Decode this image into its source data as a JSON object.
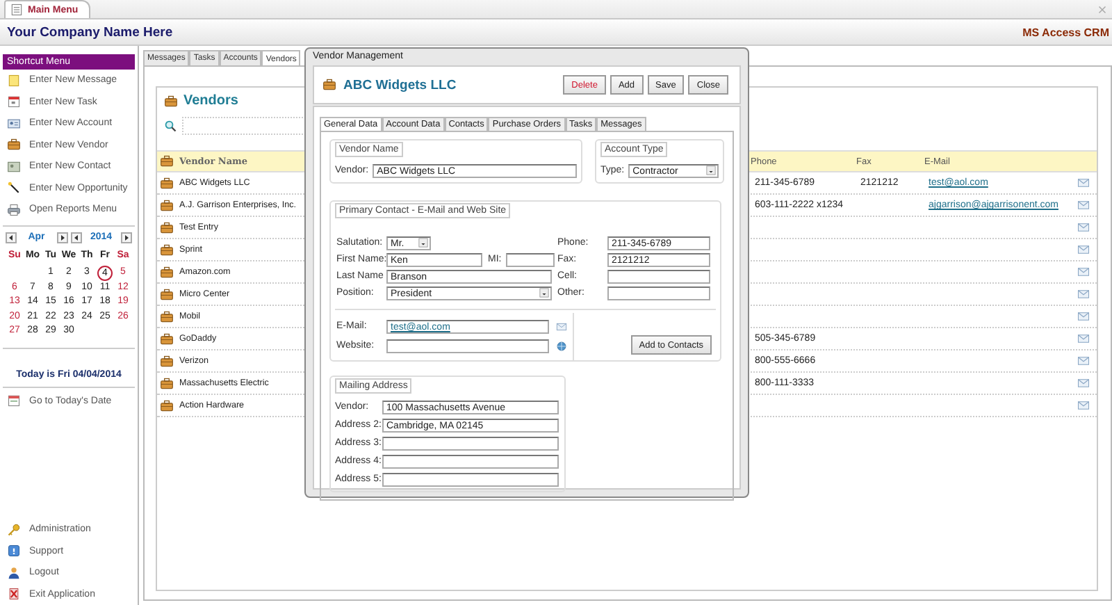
{
  "window": {
    "tab": "Main Menu"
  },
  "header": {
    "company": "Your Company Name Here",
    "app": "MS Access CRM"
  },
  "sidebar": {
    "title": "Shortcut Menu",
    "items": [
      {
        "label": "Enter New Message",
        "kind": "message"
      },
      {
        "label": "Enter New Task",
        "kind": "task"
      },
      {
        "label": "Enter New Account",
        "kind": "account"
      },
      {
        "label": "Enter New Vendor",
        "kind": "vendor"
      },
      {
        "label": "Enter New Contact",
        "kind": "contact"
      },
      {
        "label": "Enter New Opportunity",
        "kind": "opportunity"
      },
      {
        "label": "Open Reports Menu",
        "kind": "reports"
      }
    ],
    "calendar": {
      "month": "Apr",
      "year": "2014",
      "weekdays": [
        "Su",
        "Mo",
        "Tu",
        "We",
        "Th",
        "Fr",
        "Sa"
      ],
      "weeks": [
        {
          "kind": "first",
          "days": [
            {
              "day": "1",
              "circled": false
            },
            {
              "day": "2",
              "circled": false
            },
            {
              "day": "3",
              "circled": false
            },
            {
              "day": "4",
              "circled": true
            },
            {
              "day": "5",
              "circled": false
            }
          ]
        },
        {
          "kind": "full",
          "days": [
            {
              "day": "6",
              "circled": false
            },
            {
              "day": "7",
              "circled": false
            },
            {
              "day": "8",
              "circled": false
            },
            {
              "day": "9",
              "circled": false
            },
            {
              "day": "10",
              "circled": false
            },
            {
              "day": "11",
              "circled": false
            },
            {
              "day": "12",
              "circled": false
            }
          ]
        },
        {
          "kind": "full",
          "days": [
            {
              "day": "13",
              "circled": false
            },
            {
              "day": "14",
              "circled": false
            },
            {
              "day": "15",
              "circled": false
            },
            {
              "day": "16",
              "circled": false
            },
            {
              "day": "17",
              "circled": false
            },
            {
              "day": "18",
              "circled": false
            },
            {
              "day": "19",
              "circled": false
            }
          ]
        },
        {
          "kind": "full",
          "days": [
            {
              "day": "20",
              "circled": false
            },
            {
              "day": "21",
              "circled": false
            },
            {
              "day": "22",
              "circled": false
            },
            {
              "day": "23",
              "circled": false
            },
            {
              "day": "24",
              "circled": false
            },
            {
              "day": "25",
              "circled": false
            },
            {
              "day": "26",
              "circled": false
            }
          ]
        },
        {
          "kind": "last",
          "days": [
            {
              "day": "27",
              "circled": false
            },
            {
              "day": "28",
              "circled": false
            },
            {
              "day": "29",
              "circled": false
            },
            {
              "day": "30",
              "circled": false
            }
          ]
        }
      ]
    },
    "today": "Today is Fri 04/04/2014",
    "goto": {
      "label": "Go to Today's Date",
      "kind": "calendar"
    },
    "bottom_items": [
      {
        "label": "Administration",
        "kind": "key"
      },
      {
        "label": "Support",
        "kind": "help"
      },
      {
        "label": "Logout",
        "kind": "user"
      },
      {
        "label": "Exit Application",
        "kind": "exit"
      }
    ]
  },
  "tabs": [
    {
      "label": "Messages",
      "selected": false
    },
    {
      "label": "Tasks",
      "selected": false
    },
    {
      "label": "Accounts",
      "selected": false
    },
    {
      "label": "Vendors",
      "selected": true
    }
  ],
  "vendors": {
    "title": "Vendors",
    "columns": [
      "Vendor Name",
      "Phone",
      "Fax",
      "E-Mail"
    ],
    "rows": [
      {
        "name": "ABC Widgets LLC",
        "phone": "211-345-6789",
        "fax": "2121212",
        "email": "test@aol.com"
      },
      {
        "name": "A.J. Garrison Enterprises, Inc.",
        "phone": "603-111-2222 x1234",
        "email": "ajgarrison@ajgarrisonent.com"
      },
      {
        "name": "Test Entry"
      },
      {
        "name": "Sprint"
      },
      {
        "name": "Amazon.com"
      },
      {
        "name": "Micro Center"
      },
      {
        "name": "Mobil"
      },
      {
        "name": "GoDaddy",
        "phone": "505-345-6789"
      },
      {
        "name": "Verizon",
        "phone": "800-555-6666"
      },
      {
        "name": "Massachusetts Electric",
        "phone": "800-111-3333"
      },
      {
        "name": "Action Hardware"
      }
    ]
  },
  "dialog": {
    "title": "Vendor Management",
    "heading": "ABC Widgets LLC",
    "buttons": [
      {
        "label": "Delete",
        "kind": "danger"
      },
      {
        "label": "Add",
        "kind": "normal"
      },
      {
        "label": "Save",
        "kind": "normal"
      },
      {
        "label": "Close",
        "kind": "normal"
      }
    ],
    "tabs": [
      {
        "label": "General Data",
        "selected": true
      },
      {
        "label": "Account Data",
        "selected": false
      },
      {
        "label": "Contacts",
        "selected": false
      },
      {
        "label": "Purchase Orders",
        "selected": false
      },
      {
        "label": "Tasks",
        "selected": false
      },
      {
        "label": "Messages",
        "selected": false
      }
    ],
    "vendor_name": {
      "legend": "Vendor Name",
      "label": "Vendor:",
      "value": "ABC Widgets LLC"
    },
    "account_type": {
      "legend": "Account Type",
      "label": "Type:",
      "value": "Contractor"
    },
    "primary_contact": {
      "legend": "Primary Contact - E-Mail and Web Site",
      "salutation": {
        "label": "Salutation:",
        "value": "Mr."
      },
      "first_name": {
        "label": "First Name:",
        "value": "Ken"
      },
      "mi": {
        "label": "MI:"
      },
      "last_name": {
        "label": "Last Name",
        "value": "Branson"
      },
      "position": {
        "label": "Position:",
        "value": "President"
      },
      "phones": [
        {
          "label": "Phone:",
          "value": "211-345-6789"
        },
        {
          "label": "Fax:",
          "value": "2121212"
        },
        {
          "label": "Cell:"
        },
        {
          "label": "Other:"
        }
      ],
      "email": {
        "label": "E-Mail:",
        "value": "test@aol.com"
      },
      "website": {
        "label": "Website:"
      },
      "add_button": "Add to Contacts"
    },
    "mailing": {
      "legend": "Mailing Address",
      "lines": [
        {
          "label": "Vendor:",
          "value": "100 Massachusetts Avenue"
        },
        {
          "label": "Address 2:",
          "value": "Cambridge, MA 02145"
        },
        {
          "label": "Address 3:"
        },
        {
          "label": "Address 4:"
        },
        {
          "label": "Address 5:"
        }
      ]
    }
  }
}
